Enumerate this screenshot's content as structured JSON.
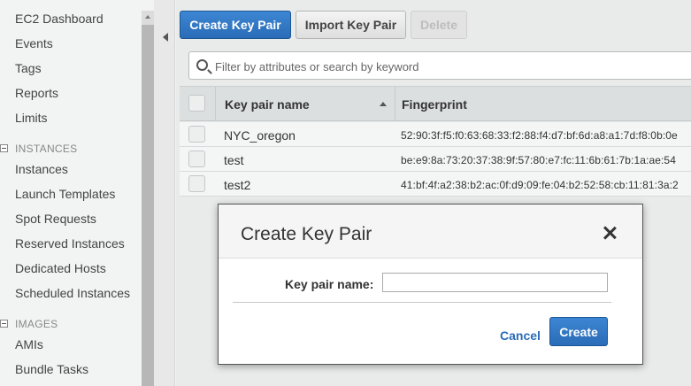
{
  "sidebar": {
    "items_top": [
      "EC2 Dashboard",
      "Events",
      "Tags",
      "Reports",
      "Limits"
    ],
    "section_instances": "INSTANCES",
    "items_instances": [
      "Instances",
      "Launch Templates",
      "Spot Requests",
      "Reserved Instances",
      "Dedicated Hosts",
      "Scheduled Instances"
    ],
    "section_images": "IMAGES",
    "items_images": [
      "AMIs",
      "Bundle Tasks"
    ]
  },
  "toolbar": {
    "create_label": "Create Key Pair",
    "import_label": "Import Key Pair",
    "delete_label": "Delete"
  },
  "search": {
    "placeholder": "Filter by attributes or search by keyword"
  },
  "table": {
    "columns": [
      "Key pair name",
      "Fingerprint"
    ],
    "rows": [
      {
        "name": "NYC_oregon",
        "fingerprint": "52:90:3f:f5:f0:63:68:33:f2:88:f4:d7:bf:6d:a8:a1:7d:f8:0b:0e"
      },
      {
        "name": "test",
        "fingerprint": "be:e9:8a:73:20:37:38:9f:57:80:e7:fc:11:6b:61:7b:1a:ae:54"
      },
      {
        "name": "test2",
        "fingerprint": "41:bf:4f:a2:38:b2:ac:0f:d9:09:fe:04:b2:52:58:cb:11:81:3a:2"
      }
    ]
  },
  "modal": {
    "title": "Create Key Pair",
    "field_label": "Key pair name:",
    "field_value": "",
    "cancel_label": "Cancel",
    "create_label": "Create"
  },
  "colors": {
    "primary": "#2a6cb7",
    "sidebar_bg": "#f2f3f3",
    "main_bg": "#e9ebeb"
  }
}
